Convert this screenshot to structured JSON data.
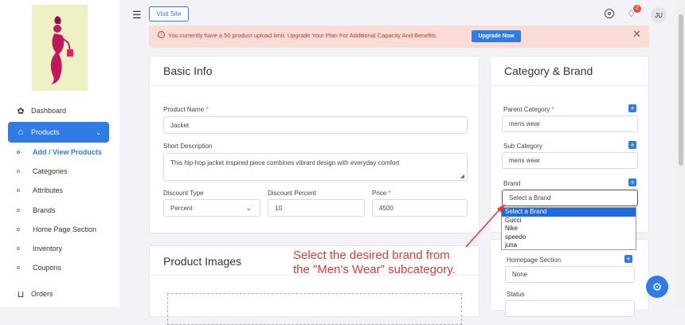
{
  "sidebar": {
    "items": [
      {
        "label": "Dashboard",
        "icon": "dashboard-icon"
      },
      {
        "label": "Products",
        "icon": "products-icon"
      },
      {
        "label": "Add / View Products"
      },
      {
        "label": "Categories"
      },
      {
        "label": "Attributes"
      },
      {
        "label": "Brands"
      },
      {
        "label": "Home Page Section"
      },
      {
        "label": "Inventory"
      },
      {
        "label": "Coupons"
      },
      {
        "label": "Orders",
        "icon": "cart-icon"
      }
    ]
  },
  "topbar": {
    "visit_site": "Visit Site",
    "notification_count": "2",
    "avatar": "JU"
  },
  "alert": {
    "text": "You currently have a 50 product upload limit. Upgrade Your Plan For Additional Capacity And Benefits.",
    "upgrade": "Upgrade Now"
  },
  "basic_info": {
    "title": "Basic Info",
    "product_name_label": "Product Name",
    "product_name": "Jacket",
    "short_desc_label": "Short Description",
    "short_desc": "This hip-hop jacket inspired piece combines vibrant design with everyday comfort",
    "discount_type_label": "Discount Type",
    "discount_type": "Percent",
    "discount_percent_label": "Discount Percent",
    "discount_percent": "10",
    "price_label": "Price",
    "price": "4500"
  },
  "product_images": {
    "title": "Product Images"
  },
  "category_brand": {
    "title": "Category & Brand",
    "parent_label": "Parent Category",
    "parent_value": "mens wear",
    "sub_label": "Sub Category",
    "sub_value": "mens wear",
    "brand_label": "Brand",
    "brand_value": "Select a Brand",
    "brand_options": [
      "Select a Brand",
      "Gucci",
      "Nike",
      "speedo",
      "juna"
    ],
    "homepage_label": "Homepage Section",
    "homepage_value": "None",
    "status_label": "Status"
  },
  "annotation": {
    "line1": "Select the desired brand from",
    "line2": "the \"Men's Wear\" subcategory."
  },
  "colors": {
    "accent": "#2f7be8",
    "alert_bg": "#f9dcd6",
    "annotation": "#e53935"
  }
}
